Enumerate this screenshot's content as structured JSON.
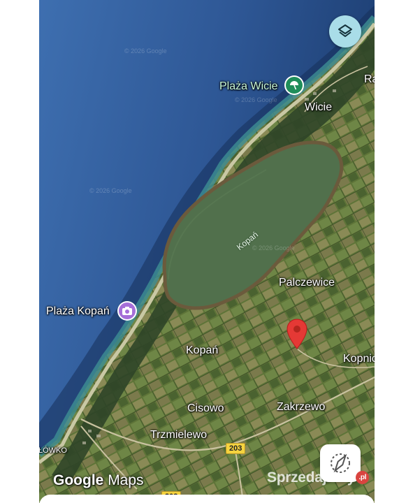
{
  "map": {
    "places": {
      "plaza_wicie": "Plaża Wicie",
      "wicie": "Wicie",
      "ra": "Ra",
      "kopan_lake": "Kopań",
      "palczewice": "Palczewice",
      "plaza_kopan": "Plaża Kopań",
      "kopan": "Kopań",
      "kopnic": "Kopnic",
      "cisowo": "Cisowo",
      "zakrzewo": "Zakrzewo",
      "trzmielewo": "Trzmielewo",
      "lowko": "ŁÓWKO"
    },
    "roads": {
      "r1": "203",
      "r2": "203"
    },
    "watermark": "© 2026 Google",
    "logo": {
      "google": "Google",
      "maps": "Maps"
    },
    "site_watermark": {
      "name": "Sprzedajemy",
      "tld": ".pl"
    },
    "icons": {
      "layers": "layers-icon",
      "recenter": "compass-recenter-icon",
      "beach": "beach-umbrella-icon",
      "photo": "camera-icon",
      "pin": "location-pin-icon"
    },
    "colors": {
      "sea": "#2f5a9a",
      "lake": "#51704c",
      "land": "#566b36",
      "pin": "#e53935",
      "beach_poi": "#1e8e5a",
      "photo_poi": "#a66fd8",
      "layers_button": "#a9dde8"
    }
  }
}
